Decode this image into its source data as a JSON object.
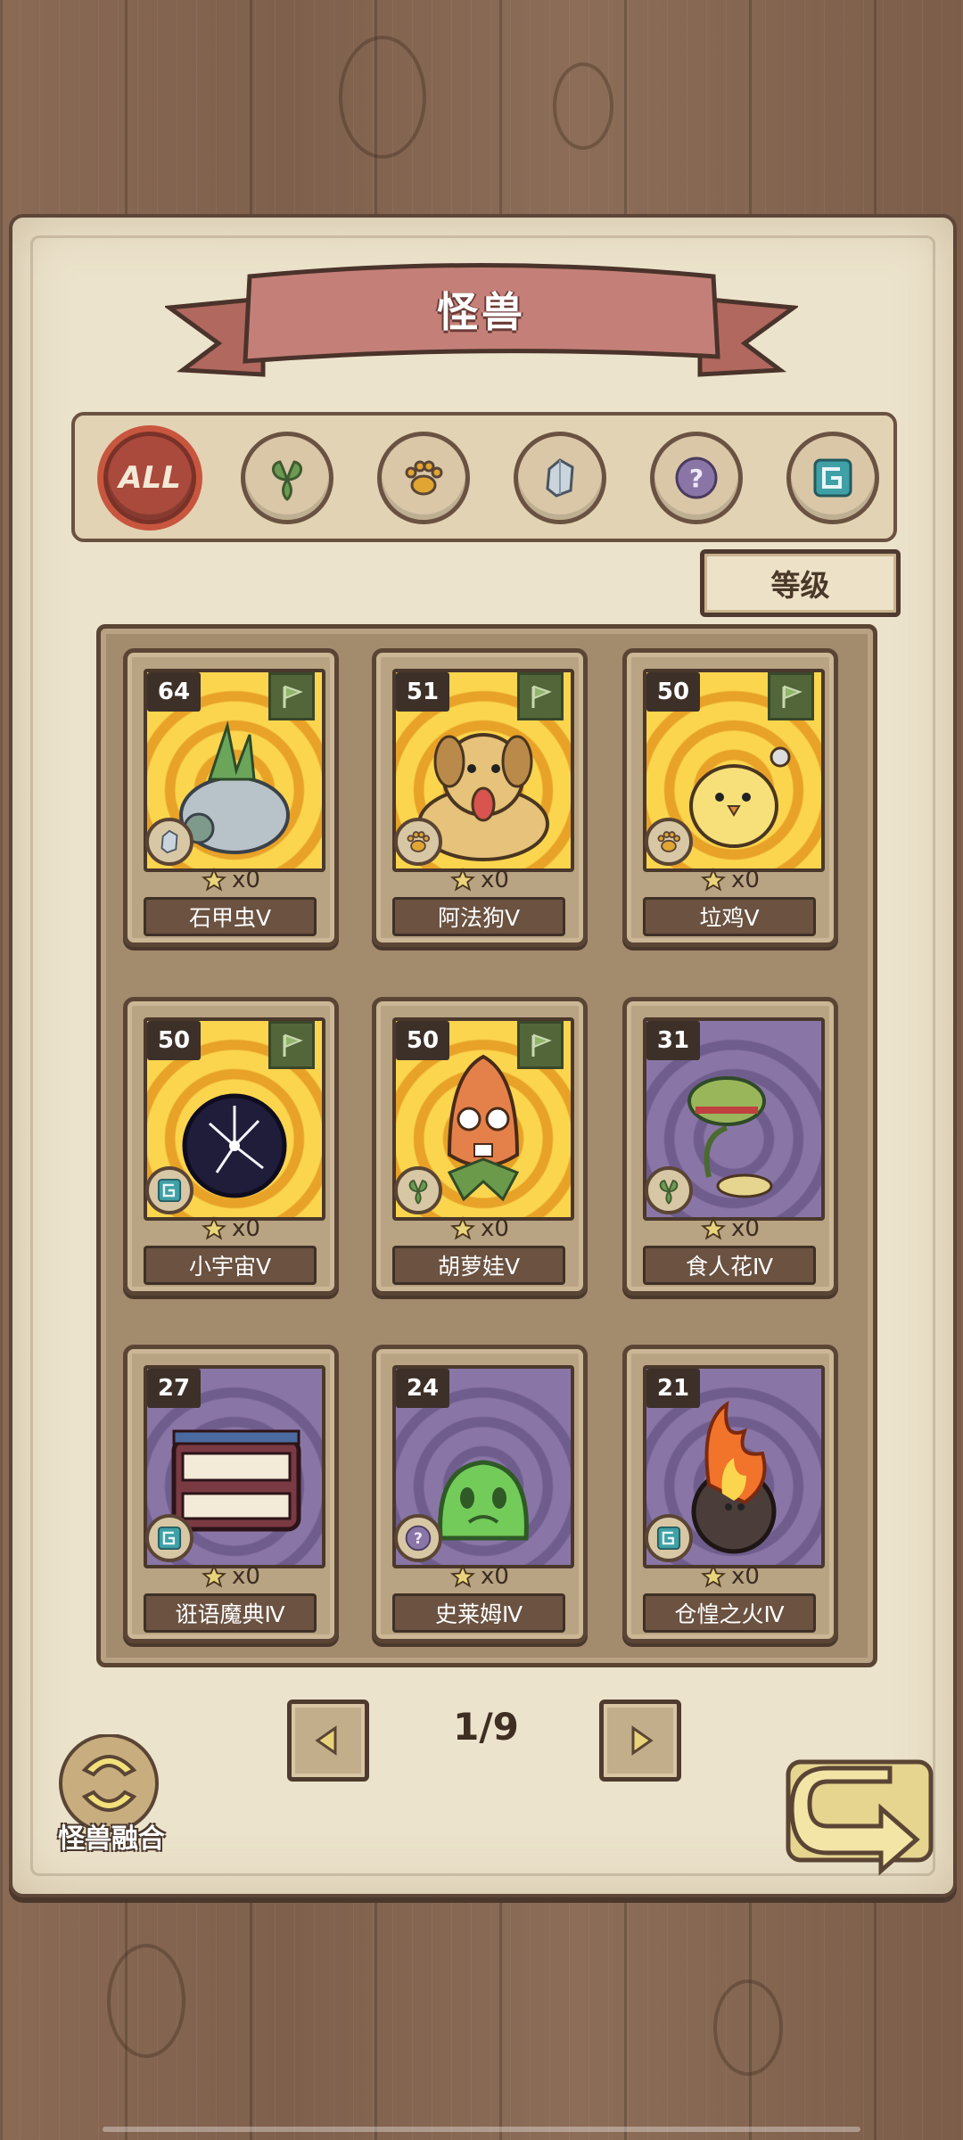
{
  "header": {
    "title": "怪兽"
  },
  "categories": [
    {
      "id": "all",
      "label": "ALL",
      "icon": "all-icon",
      "selected": true
    },
    {
      "id": "plant",
      "icon": "leaf-icon",
      "selected": false
    },
    {
      "id": "beast",
      "icon": "paw-icon",
      "selected": false
    },
    {
      "id": "mineral",
      "icon": "crystal-icon",
      "selected": false
    },
    {
      "id": "unknown",
      "icon": "question-icon",
      "selected": false
    },
    {
      "id": "arcane",
      "icon": "spiral-icon",
      "selected": false
    }
  ],
  "sort": {
    "label": "等级"
  },
  "monsters": [
    {
      "level": "64",
      "name": "石甲虫Ⅴ",
      "count": "x0",
      "type_icon": "crystal-icon",
      "flag": true,
      "bg": "gold"
    },
    {
      "level": "51",
      "name": "阿法狗Ⅴ",
      "count": "x0",
      "type_icon": "paw-icon",
      "flag": true,
      "bg": "gold"
    },
    {
      "level": "50",
      "name": "垃鸡Ⅴ",
      "count": "x0",
      "type_icon": "paw-icon",
      "flag": true,
      "bg": "gold"
    },
    {
      "level": "50",
      "name": "小宇宙Ⅴ",
      "count": "x0",
      "type_icon": "spiral-icon",
      "flag": true,
      "bg": "gold"
    },
    {
      "level": "50",
      "name": "胡萝娃Ⅴ",
      "count": "x0",
      "type_icon": "leaf-icon",
      "flag": true,
      "bg": "gold"
    },
    {
      "level": "31",
      "name": "食人花Ⅳ",
      "count": "x0",
      "type_icon": "leaf-icon",
      "flag": false,
      "bg": "purple"
    },
    {
      "level": "27",
      "name": "诳语魔典Ⅳ",
      "count": "x0",
      "type_icon": "spiral-icon",
      "flag": false,
      "bg": "purple"
    },
    {
      "level": "24",
      "name": "史莱姆Ⅳ",
      "count": "x0",
      "type_icon": "question-icon",
      "flag": false,
      "bg": "purple"
    },
    {
      "level": "21",
      "name": "仓惶之火Ⅳ",
      "count": "x0",
      "type_icon": "spiral-icon",
      "flag": false,
      "bg": "purple"
    }
  ],
  "pagination": {
    "label": "1/9",
    "current": 1,
    "total": 9
  },
  "fusion": {
    "label": "怪兽融合"
  },
  "colors": {
    "accent_red": "#a94a3c",
    "paper": "#ece3cc",
    "frame": "#5a4535",
    "gold": "#fbd54e",
    "purple": "#8a76a6"
  }
}
